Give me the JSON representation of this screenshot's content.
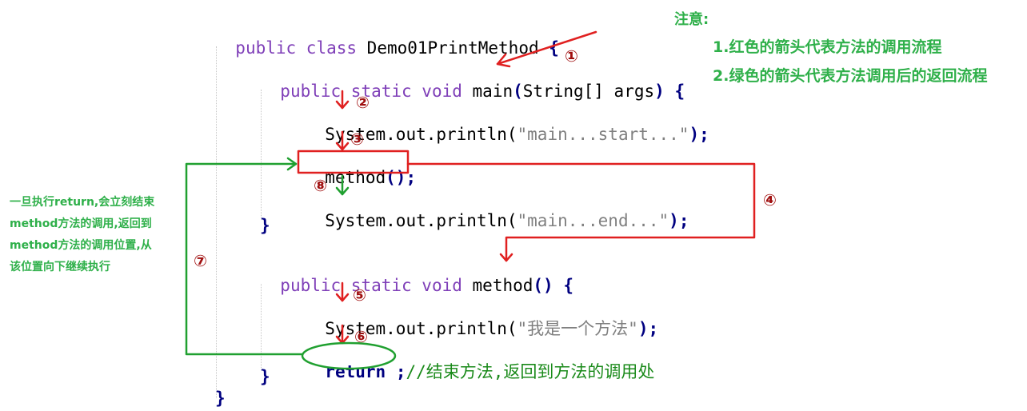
{
  "code": {
    "class_decl": {
      "kw": "public class",
      "name": "Demo01PrintMethod",
      "brace": "{"
    },
    "main_decl": {
      "kw": "public static void",
      "name": "main",
      "paren_open": "(",
      "params": "String[] args",
      "paren_close": ")",
      "brace": "{"
    },
    "main_line1": {
      "call": "System.out.println(",
      "str": "\"main...start...\"",
      "end": ");"
    },
    "main_line2": {
      "call": "method",
      "paren": "()",
      "end": ";"
    },
    "main_line3": {
      "call": "System.out.println(",
      "str": "\"main...end...\"",
      "end": ");"
    },
    "main_close": "}",
    "method_decl": {
      "kw": "public static void",
      "name": "method",
      "paren": "()",
      "brace": "{"
    },
    "method_line1": {
      "call": "System.out.println(",
      "str": "\"我是一个方法\"",
      "end": ");"
    },
    "method_line2": {
      "kw": "return",
      "semicolon": ";",
      "comment": "//结束方法,返回到方法的调用处"
    },
    "method_close": "}",
    "class_close": "}"
  },
  "notes": {
    "title": "注意:",
    "item1": "1.红色的箭头代表方法的调用流程",
    "item2": "2.绿色的箭头代表方法调用后的返回流程"
  },
  "side_note": {
    "line1": "一旦执行return,会立刻结束",
    "line2": "method方法的调用,返回到",
    "line3": "method方法的调用位置,从",
    "line4": "该位置向下继续执行"
  },
  "steps": [
    "①",
    "②",
    "③",
    "④",
    "⑤",
    "⑥",
    "⑦",
    "⑧"
  ],
  "colors": {
    "call_flow": "#e02020",
    "return_flow": "#20a030",
    "step_number": "#a01010"
  }
}
